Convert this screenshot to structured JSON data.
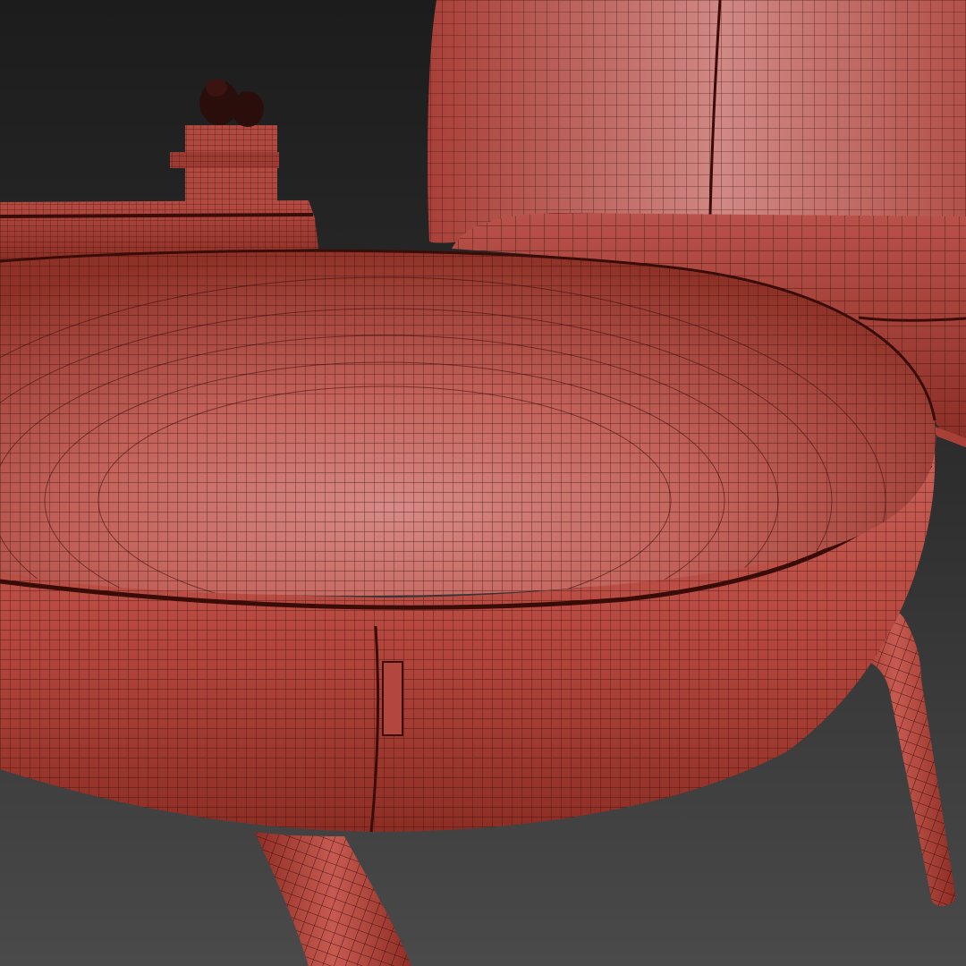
{
  "scene": {
    "subject": "wireframe-render",
    "colors": {
      "background_top": "#1e1e1e",
      "background_bottom": "#4a4a4a",
      "mesh_fill": "#c0564b",
      "mesh_highlight": "#d98a85",
      "mesh_shadow": "#7a2a22",
      "wire": "#3a0c08"
    },
    "objects": [
      {
        "name": "seat-cushion"
      },
      {
        "name": "backrest"
      },
      {
        "name": "back-cushion"
      },
      {
        "name": "side-table"
      },
      {
        "name": "cactus-pot"
      },
      {
        "name": "cactus"
      },
      {
        "name": "front-leg"
      },
      {
        "name": "rear-leg"
      }
    ]
  }
}
